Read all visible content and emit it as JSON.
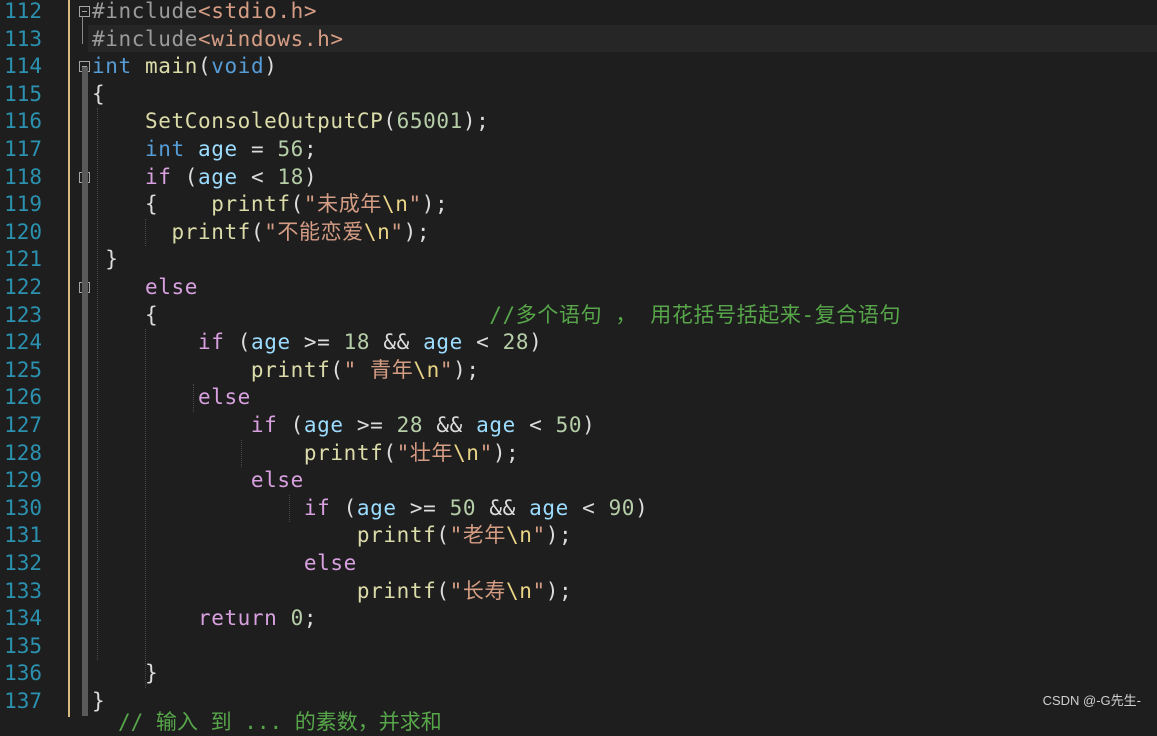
{
  "editor": {
    "lines": [
      {
        "num": "112",
        "tokens": [
          {
            "t": "#include",
            "c": "k-pp"
          },
          {
            "t": "<stdio.h>",
            "c": "k-inc"
          }
        ]
      },
      {
        "num": "113",
        "tokens": [
          {
            "t": "#include",
            "c": "k-pp"
          },
          {
            "t": "<windows.h>",
            "c": "k-inc"
          }
        ]
      },
      {
        "num": "114",
        "tokens": [
          {
            "t": "int",
            "c": "k-kw"
          },
          {
            "t": " "
          },
          {
            "t": "main",
            "c": "k-fn"
          },
          {
            "t": "("
          },
          {
            "t": "void",
            "c": "k-kw"
          },
          {
            "t": ")"
          }
        ]
      },
      {
        "num": "115",
        "tokens": [
          {
            "t": "{"
          }
        ]
      },
      {
        "num": "116",
        "tokens": [
          {
            "t": "    "
          },
          {
            "t": "SetConsoleOutputCP",
            "c": "k-fn"
          },
          {
            "t": "("
          },
          {
            "t": "65001",
            "c": "k-num"
          },
          {
            "t": ");"
          }
        ]
      },
      {
        "num": "117",
        "tokens": [
          {
            "t": "    "
          },
          {
            "t": "int",
            "c": "k-kw"
          },
          {
            "t": " "
          },
          {
            "t": "age",
            "c": "k-var"
          },
          {
            "t": " = "
          },
          {
            "t": "56",
            "c": "k-num"
          },
          {
            "t": ";"
          }
        ]
      },
      {
        "num": "118",
        "tokens": [
          {
            "t": "    "
          },
          {
            "t": "if",
            "c": "k-ctl"
          },
          {
            "t": " ("
          },
          {
            "t": "age",
            "c": "k-var"
          },
          {
            "t": " < "
          },
          {
            "t": "18",
            "c": "k-num"
          },
          {
            "t": ")"
          }
        ]
      },
      {
        "num": "119",
        "tokens": [
          {
            "t": "    {    "
          },
          {
            "t": "printf",
            "c": "k-fn"
          },
          {
            "t": "("
          },
          {
            "t": "\"未成年",
            "c": "k-str"
          },
          {
            "t": "\\n",
            "c": "k-esc"
          },
          {
            "t": "\"",
            "c": "k-str"
          },
          {
            "t": ");"
          }
        ]
      },
      {
        "num": "120",
        "tokens": [
          {
            "t": "      "
          },
          {
            "t": "printf",
            "c": "k-fn"
          },
          {
            "t": "("
          },
          {
            "t": "\"不能恋爱",
            "c": "k-str"
          },
          {
            "t": "\\n",
            "c": "k-esc"
          },
          {
            "t": "\"",
            "c": "k-str"
          },
          {
            "t": ");"
          }
        ]
      },
      {
        "num": "121",
        "tokens": [
          {
            "t": " }"
          }
        ]
      },
      {
        "num": "122",
        "tokens": [
          {
            "t": "    "
          },
          {
            "t": "else",
            "c": "k-ctl"
          }
        ]
      },
      {
        "num": "123",
        "tokens": [
          {
            "t": "    {                         "
          },
          {
            "t": "//多个语句 ， 用花括号括起来-复合语句",
            "c": "k-cm"
          }
        ]
      },
      {
        "num": "124",
        "tokens": [
          {
            "t": "        "
          },
          {
            "t": "if",
            "c": "k-ctl"
          },
          {
            "t": " ("
          },
          {
            "t": "age",
            "c": "k-var"
          },
          {
            "t": " >= "
          },
          {
            "t": "18",
            "c": "k-num"
          },
          {
            "t": " && "
          },
          {
            "t": "age",
            "c": "k-var"
          },
          {
            "t": " < "
          },
          {
            "t": "28",
            "c": "k-num"
          },
          {
            "t": ")"
          }
        ]
      },
      {
        "num": "125",
        "tokens": [
          {
            "t": "            "
          },
          {
            "t": "printf",
            "c": "k-fn"
          },
          {
            "t": "("
          },
          {
            "t": "\" 青年",
            "c": "k-str"
          },
          {
            "t": "\\n",
            "c": "k-esc"
          },
          {
            "t": "\"",
            "c": "k-str"
          },
          {
            "t": ");"
          }
        ]
      },
      {
        "num": "126",
        "tokens": [
          {
            "t": "        "
          },
          {
            "t": "else",
            "c": "k-ctl"
          }
        ]
      },
      {
        "num": "127",
        "tokens": [
          {
            "t": "            "
          },
          {
            "t": "if",
            "c": "k-ctl"
          },
          {
            "t": " ("
          },
          {
            "t": "age",
            "c": "k-var"
          },
          {
            "t": " >= "
          },
          {
            "t": "28",
            "c": "k-num"
          },
          {
            "t": " && "
          },
          {
            "t": "age",
            "c": "k-var"
          },
          {
            "t": " < "
          },
          {
            "t": "50",
            "c": "k-num"
          },
          {
            "t": ")"
          }
        ]
      },
      {
        "num": "128",
        "tokens": [
          {
            "t": "                "
          },
          {
            "t": "printf",
            "c": "k-fn"
          },
          {
            "t": "("
          },
          {
            "t": "\"壮年",
            "c": "k-str"
          },
          {
            "t": "\\n",
            "c": "k-esc"
          },
          {
            "t": "\"",
            "c": "k-str"
          },
          {
            "t": ");"
          }
        ]
      },
      {
        "num": "129",
        "tokens": [
          {
            "t": "            "
          },
          {
            "t": "else",
            "c": "k-ctl"
          }
        ]
      },
      {
        "num": "130",
        "tokens": [
          {
            "t": "                "
          },
          {
            "t": "if",
            "c": "k-ctl"
          },
          {
            "t": " ("
          },
          {
            "t": "age",
            "c": "k-var"
          },
          {
            "t": " >= "
          },
          {
            "t": "50",
            "c": "k-num"
          },
          {
            "t": " && "
          },
          {
            "t": "age",
            "c": "k-var"
          },
          {
            "t": " < "
          },
          {
            "t": "90",
            "c": "k-num"
          },
          {
            "t": ")"
          }
        ]
      },
      {
        "num": "131",
        "tokens": [
          {
            "t": "                    "
          },
          {
            "t": "printf",
            "c": "k-fn"
          },
          {
            "t": "("
          },
          {
            "t": "\"老年",
            "c": "k-str"
          },
          {
            "t": "\\n",
            "c": "k-esc"
          },
          {
            "t": "\"",
            "c": "k-str"
          },
          {
            "t": ");"
          }
        ]
      },
      {
        "num": "132",
        "tokens": [
          {
            "t": "                "
          },
          {
            "t": "else",
            "c": "k-ctl"
          }
        ]
      },
      {
        "num": "133",
        "tokens": [
          {
            "t": "                    "
          },
          {
            "t": "printf",
            "c": "k-fn"
          },
          {
            "t": "("
          },
          {
            "t": "\"长寿",
            "c": "k-str"
          },
          {
            "t": "\\n",
            "c": "k-esc"
          },
          {
            "t": "\"",
            "c": "k-str"
          },
          {
            "t": ");"
          }
        ]
      },
      {
        "num": "134",
        "tokens": [
          {
            "t": "        "
          },
          {
            "t": "return",
            "c": "k-ctl"
          },
          {
            "t": " "
          },
          {
            "t": "0",
            "c": "k-num"
          },
          {
            "t": ";"
          }
        ]
      },
      {
        "num": "135",
        "tokens": []
      },
      {
        "num": "136",
        "tokens": [
          {
            "t": "    }"
          }
        ]
      },
      {
        "num": "137",
        "tokens": [
          {
            "t": "}"
          }
        ]
      }
    ],
    "folds": [
      "112",
      "114",
      "118",
      "122"
    ],
    "partial_line": "// 输入 到 ... 的素数，并求和"
  },
  "watermark": "CSDN @-G先生-",
  "colors": {
    "background": "#1e1e1e",
    "line_number": "#2b91af",
    "keyword": "#569cd6",
    "control": "#d8a0df",
    "function": "#dcdcaa",
    "string": "#d69d85",
    "number": "#b5cea8",
    "variable": "#9cdcfe",
    "comment": "#57a64a"
  }
}
